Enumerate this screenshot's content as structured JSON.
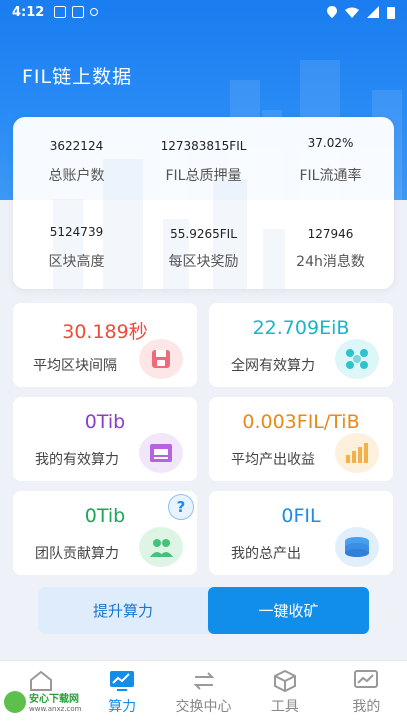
{
  "status_bar": {
    "time": "4:12"
  },
  "header": {
    "title": "FIL链上数据"
  },
  "stats": [
    {
      "value": "3622124",
      "label": "总账户数"
    },
    {
      "value": "127383815FIL",
      "label": "FIL总质押量"
    },
    {
      "value": "37.02%",
      "label": "FIL流通率"
    },
    {
      "value": "5124739",
      "label": "区块高度"
    },
    {
      "value": "55.9265FIL",
      "label": "每区块奖励"
    },
    {
      "value": "127946",
      "label": "24h消息数"
    }
  ],
  "tiles": [
    {
      "value": "30.189秒",
      "label": "平均区块间隔",
      "color": "#f04a3a",
      "icon": "save-icon"
    },
    {
      "value": "22.709EiB",
      "label": "全网有效算力",
      "color": "#1bb5c4",
      "icon": "network-icon"
    },
    {
      "value": "0Tib",
      "label": "我的有效算力",
      "color": "#8b3fc9",
      "icon": "storage-icon"
    },
    {
      "value": "0.003FIL/TiB",
      "label": "平均产出收益",
      "color": "#e88a17",
      "icon": "bar-chart-icon"
    },
    {
      "value": "0Tib",
      "label": "团队贡献算力",
      "color": "#1ca65a",
      "icon": "team-icon"
    },
    {
      "value": "0FIL",
      "label": "我的总产出",
      "color": "#1d8be8",
      "icon": "coin-stack-icon"
    }
  ],
  "help": {
    "glyph": "?"
  },
  "buttons": {
    "boost": "提升算力",
    "harvest": "一键收矿"
  },
  "tabbar": [
    {
      "label": "首页",
      "icon": "home-icon"
    },
    {
      "label": "算力",
      "icon": "monitor-icon",
      "active": true
    },
    {
      "label": "交换中心",
      "icon": "exchange-icon"
    },
    {
      "label": "工具",
      "icon": "cube-icon"
    },
    {
      "label": "我的",
      "icon": "profile-chart-icon"
    }
  ],
  "watermark": {
    "brand": "安心下载网",
    "url": "www.anxz.com"
  },
  "colors": {
    "primary": "#108ee9",
    "header": "#1a7df0"
  }
}
